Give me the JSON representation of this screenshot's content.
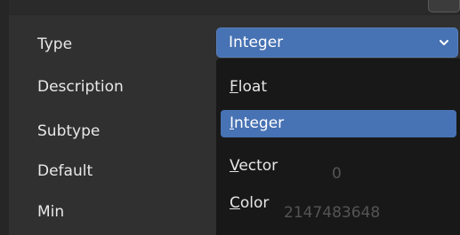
{
  "properties": {
    "type_label": "Type",
    "description_label": "Description",
    "subtype_label": "Subtype",
    "default_label": "Default",
    "min_label": "Min"
  },
  "type_select": {
    "value": "Integer",
    "icon": "chevron-down-icon"
  },
  "dropdown": {
    "options": [
      {
        "accel": "F",
        "rest": "loat"
      },
      {
        "accel": "I",
        "rest": "nteger"
      },
      {
        "accel": "V",
        "rest": "ector"
      },
      {
        "accel": "C",
        "rest": "olor"
      }
    ],
    "selected": "Integer"
  },
  "background_values": {
    "default_value": "0",
    "min_value": "2147483648"
  },
  "colors": {
    "panel_bg": "#303030",
    "accent": "#4772b3",
    "menu_bg": "#181818",
    "text": "#e6e6e6"
  }
}
